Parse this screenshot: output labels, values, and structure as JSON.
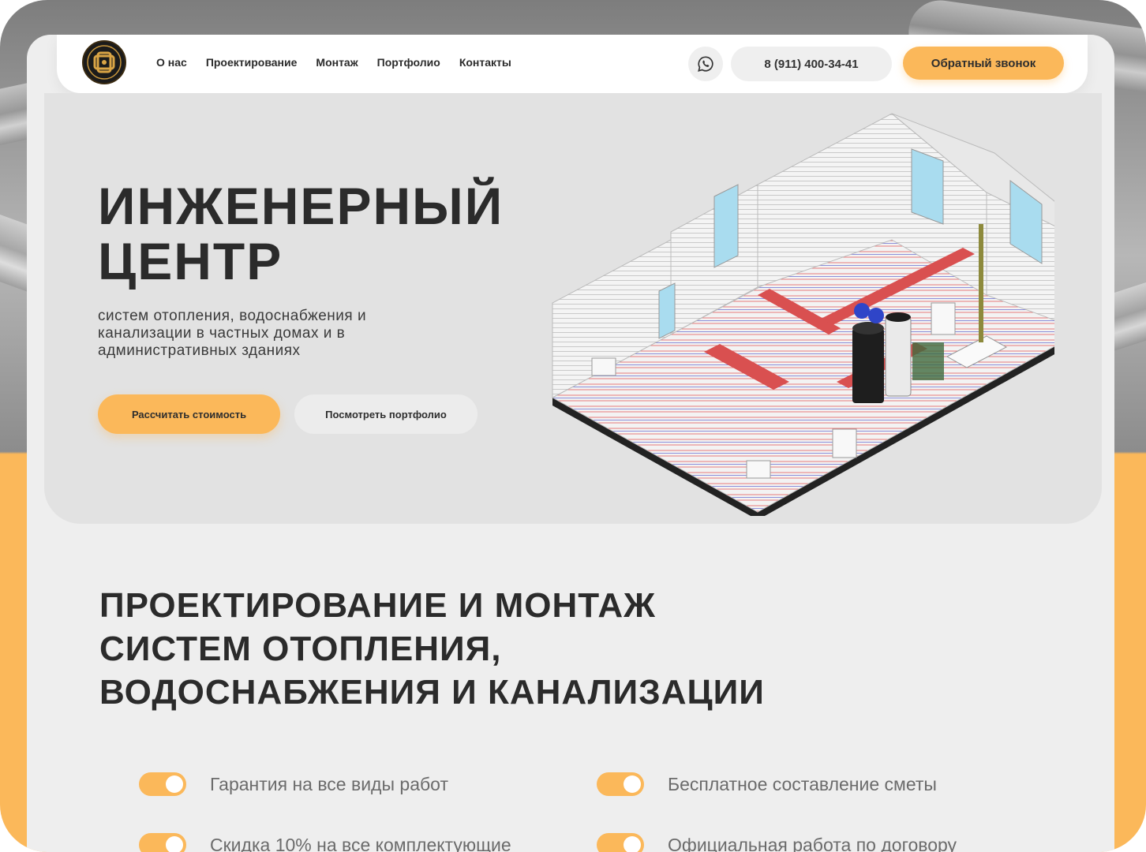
{
  "nav": {
    "logo_icon": "company-logo",
    "items": [
      {
        "label": "О нас"
      },
      {
        "label": "Проектирование"
      },
      {
        "label": "Монтаж"
      },
      {
        "label": "Портфолио"
      },
      {
        "label": "Контакты"
      }
    ],
    "whatsapp_icon": "whatsapp-icon",
    "phone": "8 (911) 400-34-41",
    "callback_label": "Обратный звонок"
  },
  "hero": {
    "title_line1": "ИНЖЕНЕРНЫЙ",
    "title_line2": "ЦЕНТР",
    "subtitle": "систем отопления, водоснабжения и канализации в частных домах и в административных зданиях",
    "calc_button": "Рассчитать стоимость",
    "portfolio_button": "Посмотреть портфолио"
  },
  "services": {
    "title_line1": "ПРОЕКТИРОВАНИЕ И МОНТАЖ",
    "title_line2": "СИСТЕМ ОТОПЛЕНИЯ,",
    "title_line3": "ВОДОСНАБЖЕНИЯ И КАНАЛИЗАЦИИ",
    "features": [
      {
        "label": "Гарантия на все виды работ",
        "on": true
      },
      {
        "label": "Бесплатное составление сметы",
        "on": true
      },
      {
        "label": "Скидка 10% на все комплектующие",
        "on": true
      },
      {
        "label": "Официальная работа по договору",
        "on": true
      }
    ]
  },
  "colors": {
    "accent": "#fbb85a",
    "text": "#2b2b2b",
    "hero_bg": "#e2e2e2",
    "page_bg": "#eeeeee"
  }
}
